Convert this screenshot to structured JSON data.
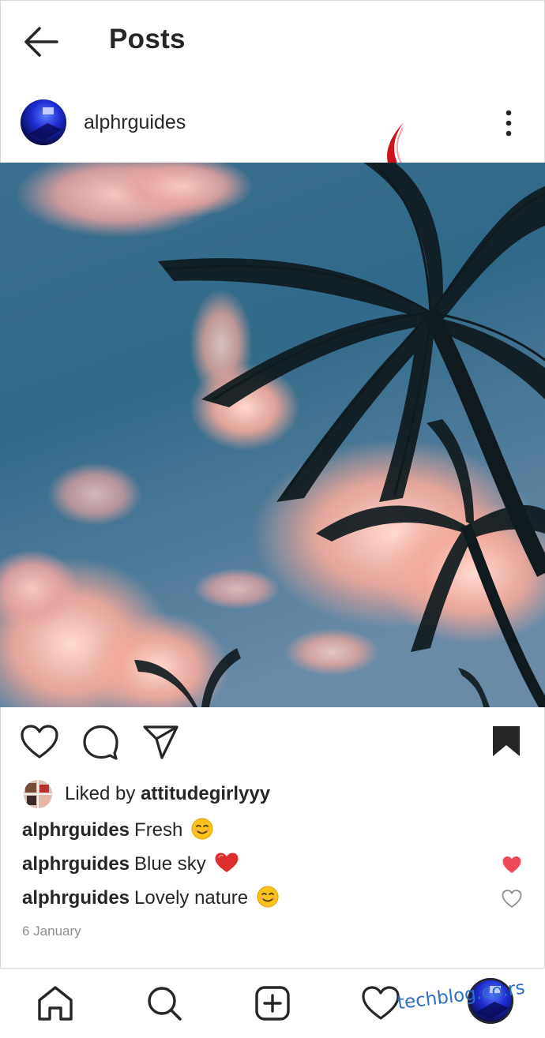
{
  "header": {
    "title": "Posts",
    "back_icon": "arrow-left-icon"
  },
  "post": {
    "username": "alphrguides",
    "more_icon": "more-vertical-icon",
    "annotation": "red-curved-arrow"
  },
  "photo": {
    "description_icon": "palm-tree-sunset-photo"
  },
  "actions": {
    "like_icon": "heart-outline-icon",
    "comment_icon": "comment-bubble-icon",
    "share_icon": "send-paper-plane-icon",
    "save_icon": "bookmark-filled-icon"
  },
  "likes": {
    "prefix": "Liked by",
    "user": "attitudegirlyyy"
  },
  "comments": [
    {
      "user": "alphrguides",
      "text": "Fresh",
      "emoji": "smiling-face",
      "liked": false,
      "show_like": false
    },
    {
      "user": "alphrguides",
      "text": "Blue sky",
      "emoji": "red-heart",
      "liked": true,
      "show_like": true
    },
    {
      "user": "alphrguides",
      "text": "Lovely nature",
      "emoji": "smiling-face",
      "liked": false,
      "show_like": true
    }
  ],
  "date": "6 January",
  "bottom_nav": [
    {
      "name": "home",
      "icon": "home-icon"
    },
    {
      "name": "search",
      "icon": "search-icon"
    },
    {
      "name": "new-post",
      "icon": "plus-square-icon"
    },
    {
      "name": "activity",
      "icon": "heart-outline-icon"
    },
    {
      "name": "profile",
      "icon": "profile-avatar"
    }
  ],
  "watermark": "techblog.co.rs",
  "colors": {
    "text": "#262626",
    "muted": "#8e8e8e",
    "like_red": "#ed4956",
    "annotation_red": "#d0101a",
    "watermark_blue": "#2f6fc0"
  }
}
